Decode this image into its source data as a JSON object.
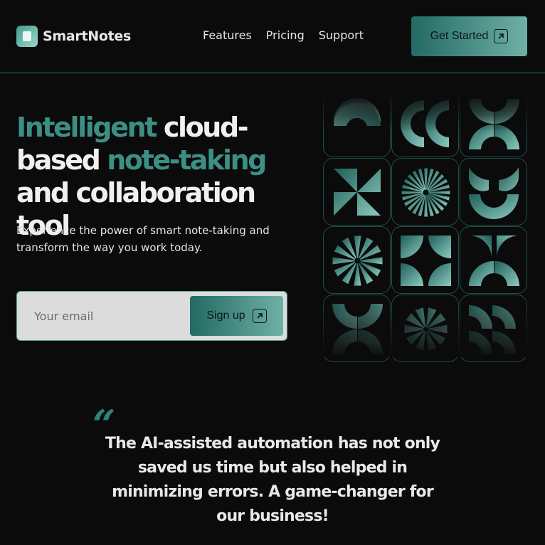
{
  "brand": {
    "name": "SmartNotes",
    "logo_icon": "note-icon"
  },
  "nav": {
    "items": [
      "Features",
      "Pricing",
      "Support"
    ]
  },
  "header": {
    "cta_label": "Get Started",
    "cta_icon": "arrow-up-right-icon"
  },
  "hero": {
    "title_part1": "Intelligent",
    "title_part2": " cloud-based ",
    "title_part3": "note-taking",
    "title_part4": " and collaboration tool",
    "subtitle": "Experience the power of smart note-taking and transform the way you work today."
  },
  "signup": {
    "placeholder": "Your email",
    "button_label": "Sign up",
    "button_icon": "arrow-up-right-icon"
  },
  "testimonial": {
    "quote_mark": "“",
    "text": "The AI-assisted automation has not only saved us time but also helped in minimizing errors. A game-changer for our business!"
  },
  "colors": {
    "accent": "#3c8f84",
    "background": "#0b0b0b",
    "button_gradient_start": "#226a64",
    "button_gradient_end": "#6fb0a6"
  },
  "decor_grid": {
    "icons": [
      "arch-halves-icon",
      "brackets-icon",
      "crescents-icon",
      "pinwheel-icon",
      "sunburst-icon",
      "smile-arc-icon",
      "starburst-icon",
      "quarter-circles-icon",
      "bowtie-arcs-icon",
      "bowtie-arcs-icon",
      "flower-icon",
      "brackets-icon"
    ]
  }
}
